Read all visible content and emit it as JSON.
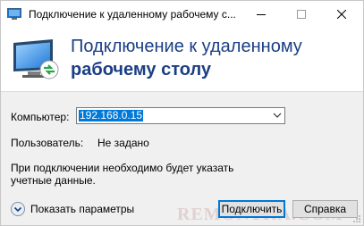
{
  "titlebar": {
    "title": "Подключение к удаленному рабочему с...",
    "minimize_icon": "minimize-icon",
    "maximize_icon": "maximize-icon",
    "close_icon": "close-icon"
  },
  "header": {
    "line1": "Подключение к удаленному",
    "line2": "рабочему столу",
    "accent_color": "#1b3f86"
  },
  "form": {
    "computer_label": "Компьютер:",
    "computer_value": "192.168.0.15",
    "user_label": "Пользователь:",
    "user_value": "Не задано",
    "info_text": "При подключении необходимо будет указать учетные данные."
  },
  "footer": {
    "show_params": "Показать параметры",
    "connect_button": "Подключить",
    "help_button": "Справка"
  },
  "watermark": "REMONTKA.COM",
  "colors": {
    "selection": "#0078d7",
    "window_bg": "#f0f0f0"
  }
}
